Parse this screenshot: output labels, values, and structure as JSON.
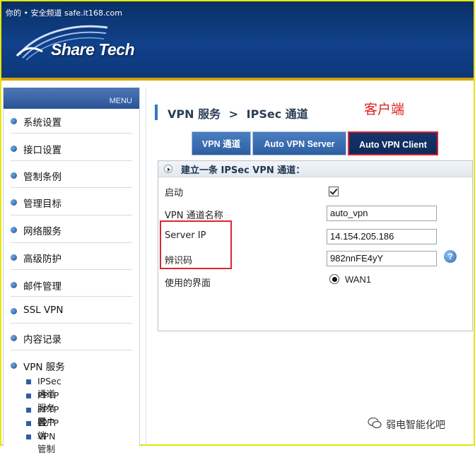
{
  "watermark": "你的 • 安全频道 safe.it168.com",
  "logo": "Share Tech",
  "menu": {
    "header": "MENU",
    "items": [
      {
        "label": "系统设置"
      },
      {
        "label": "接口设置"
      },
      {
        "label": "管制条例"
      },
      {
        "label": "管理目标"
      },
      {
        "label": "网络服务"
      },
      {
        "label": "高级防护"
      },
      {
        "label": "邮件管理"
      },
      {
        "label": "SSL VPN"
      },
      {
        "label": "内容记录"
      },
      {
        "label": "VPN 服务"
      }
    ],
    "subitems": [
      {
        "label": "IPSec 通道"
      },
      {
        "label": "PPTP 服务器"
      },
      {
        "label": "PPTP 客户端"
      },
      {
        "label": "L2TP"
      },
      {
        "label": "VPN 管制"
      }
    ]
  },
  "breadcrumb": {
    "part1": "VPN 服务",
    "separator": ">",
    "part2": "IPSec 通道"
  },
  "annotation": "客户端",
  "tabs": [
    {
      "label": "VPN 通道"
    },
    {
      "label": "Auto VPN Server"
    },
    {
      "label": "Auto VPN Client"
    }
  ],
  "form": {
    "heading": "建立一条 IPSec VPN 通道：",
    "enable_label": "启动",
    "enable_checked": true,
    "name_label": "VPN 通道名称",
    "name_value": "auto_vpn",
    "server_ip_label": "Server IP",
    "server_ip_value": "14.154.205.186",
    "id_label": "辨识码",
    "id_value": "982nnFE4yY",
    "interface_label": "使用的界面",
    "interface_value": "WAN1",
    "help_icon": "?"
  },
  "brand": "弱电智能化吧",
  "colors": {
    "header_bg": "#11418a",
    "header_stripe": "#d6a400",
    "accent_red": "#e0242f",
    "tab_bg": "#2d5ea3",
    "tab_active_bg": "#0d2a5a"
  }
}
